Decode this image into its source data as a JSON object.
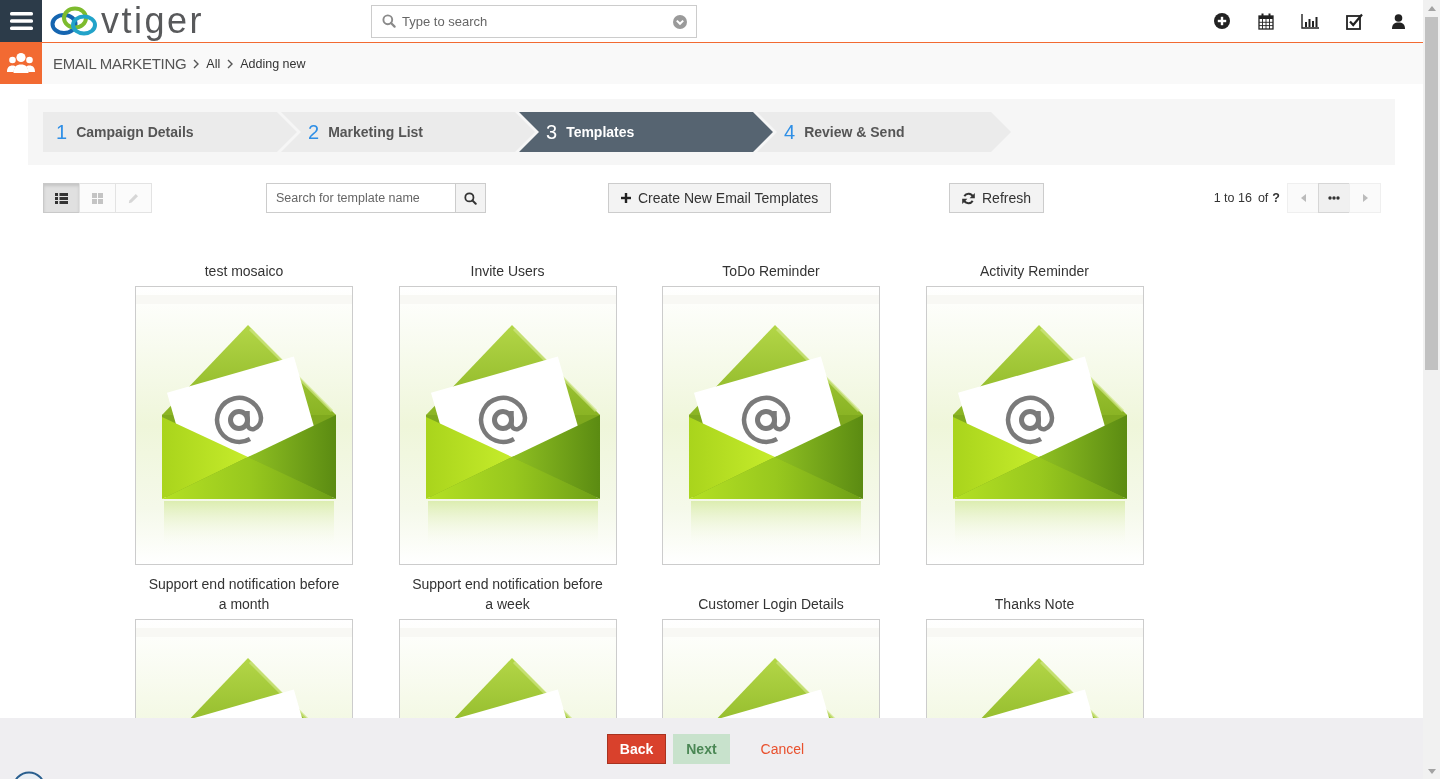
{
  "topbar": {
    "logo": "vtiger",
    "search": {
      "placeholder": "Type to search"
    }
  },
  "breadcrumb": {
    "module": "EMAIL MARKETING",
    "items": [
      "All",
      "Adding new"
    ]
  },
  "steps": [
    {
      "number": "1",
      "label": "Campaign Details",
      "selected": false
    },
    {
      "number": "2",
      "label": "Marketing List",
      "selected": false
    },
    {
      "number": "3",
      "label": "Templates",
      "selected": true
    },
    {
      "number": "4",
      "label": "Review & Send",
      "selected": false
    }
  ],
  "toolbar": {
    "views": [
      {
        "kind": "list",
        "selected": true,
        "disabled": false
      },
      {
        "kind": "grid",
        "selected": false,
        "disabled": false
      },
      {
        "kind": "edit",
        "selected": false,
        "disabled": true
      }
    ],
    "template_search": {
      "placeholder": "Search for template name"
    },
    "create_button": "Create New Email Templates",
    "refresh_button": "Refresh",
    "pagination": {
      "range": "1 to 16",
      "of": "of",
      "total": "?",
      "buttons": [
        {
          "kind": "prev",
          "disabled": true
        },
        {
          "kind": "more",
          "disabled": false
        },
        {
          "kind": "next",
          "disabled": true
        }
      ]
    }
  },
  "templates": [
    {
      "name": "test mosaico"
    },
    {
      "name": "Invite Users"
    },
    {
      "name": "ToDo Reminder"
    },
    {
      "name": "Activity Reminder"
    },
    {
      "name": "Support end notification before a month"
    },
    {
      "name": "Support end notification before a week"
    },
    {
      "name": "Customer Login Details"
    },
    {
      "name": "Thanks Note"
    }
  ],
  "footer": {
    "buttons": [
      {
        "label": "Back",
        "kind": "danger",
        "disabled": false
      },
      {
        "label": "Next",
        "kind": "success",
        "disabled": true
      },
      {
        "label": "Cancel",
        "kind": "link",
        "disabled": false
      }
    ]
  }
}
